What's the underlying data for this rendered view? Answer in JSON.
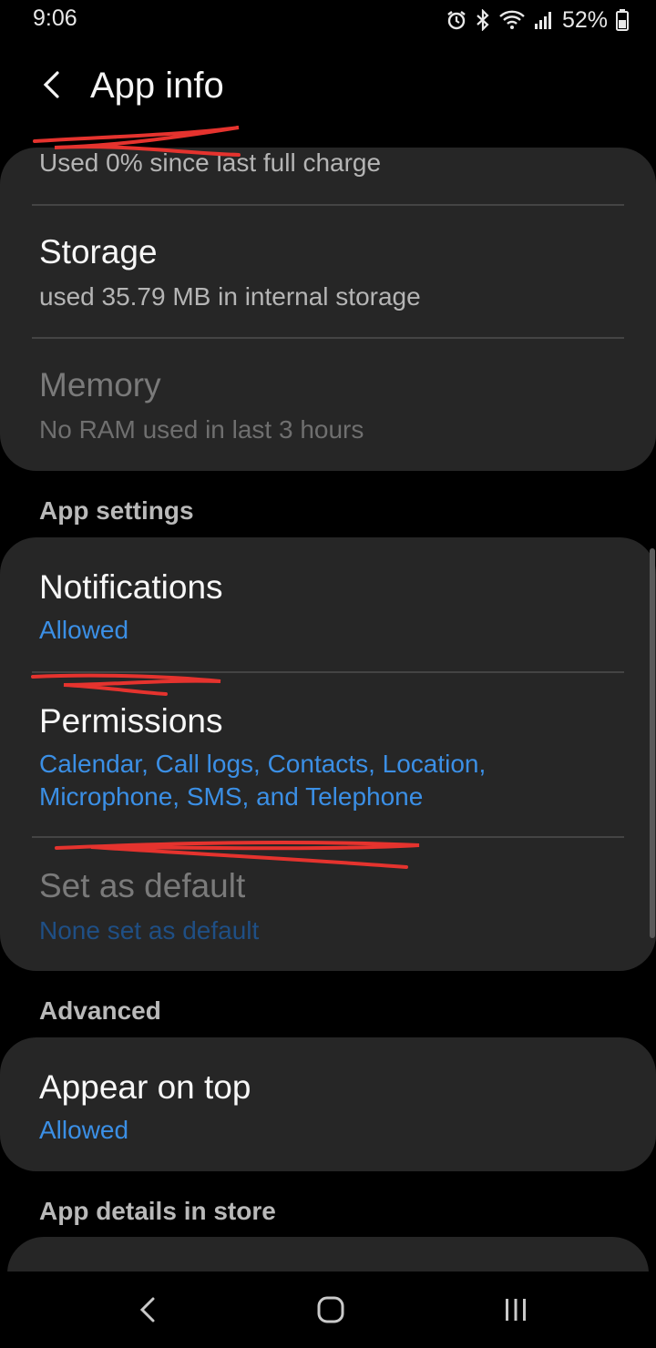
{
  "status_bar": {
    "time": "9:06",
    "battery": "52%",
    "icons": [
      "alarm-icon",
      "bluetooth-icon",
      "wifi-icon",
      "signal-icon",
      "battery-icon"
    ]
  },
  "header": {
    "title": "App info",
    "back_icon": "back-arrow-icon"
  },
  "usage_card": {
    "battery_sub": "Used 0% since last full charge",
    "storage_title": "Storage",
    "storage_sub": "used 35.79 MB in internal storage",
    "memory_title": "Memory",
    "memory_sub": "No RAM used in last 3 hours"
  },
  "app_settings": {
    "header": "App settings",
    "notifications_title": "Notifications",
    "notifications_sub": "Allowed",
    "permissions_title": "Permissions",
    "permissions_sub_line1": "Calendar, Call logs, Contacts, Location,",
    "permissions_sub_line2": "Microphone, SMS, and Telephone",
    "default_title": "Set as default",
    "default_sub": "None set as default"
  },
  "advanced": {
    "header": "Advanced",
    "appear_title": "Appear on top",
    "appear_sub": "Allowed"
  },
  "store": {
    "header": "App details in store"
  },
  "nav_bar": {
    "buttons": [
      "back-icon",
      "home-icon",
      "recents-icon"
    ]
  },
  "colors": {
    "background": "#000000",
    "card": "#262626",
    "accent_blue": "#3b8fe5",
    "annotation_red": "#e5332e"
  }
}
